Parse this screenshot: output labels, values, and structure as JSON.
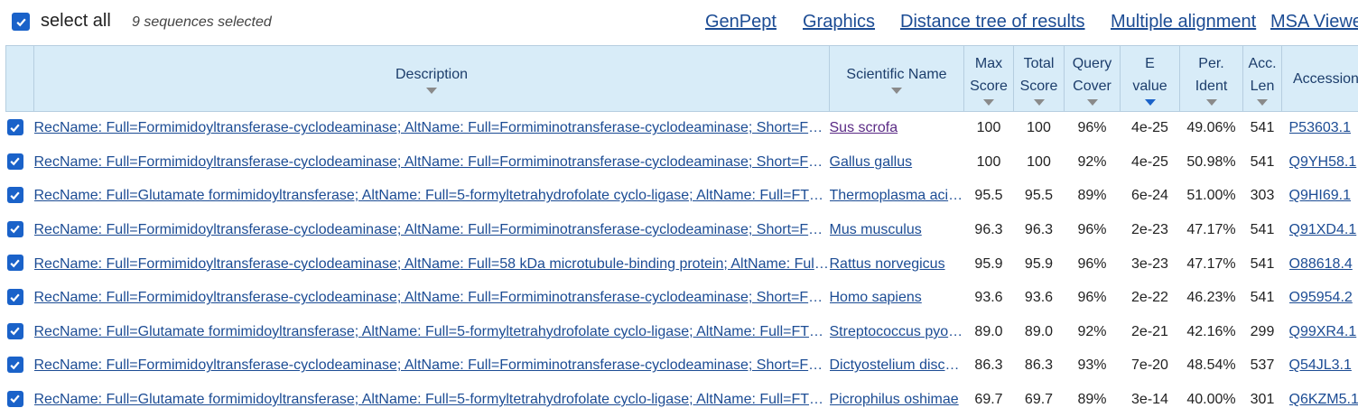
{
  "toolbar": {
    "select_all_label": "select all",
    "selected_count": "9 sequences selected",
    "links": [
      "GenPept",
      "Graphics",
      "Distance tree of results",
      "Multiple alignment",
      "MSA Viewer"
    ]
  },
  "colors": {
    "checkbox": "#1a62c9",
    "header_bg": "#d8ecf8",
    "link": "#1c4c94",
    "visited_link": "#5a2a85"
  },
  "table": {
    "headers": {
      "description": "Description",
      "scientific_name": "Scientific Name",
      "max_score_1": "Max",
      "max_score_2": "Score",
      "total_score_1": "Total",
      "total_score_2": "Score",
      "query_cover_1": "Query",
      "query_cover_2": "Cover",
      "evalue_1": "E",
      "evalue_2": "value",
      "per_ident_1": "Per.",
      "per_ident_2": "Ident",
      "acc_len_1": "Acc.",
      "acc_len_2": "Len",
      "accession": "Accession"
    },
    "rows": [
      {
        "description": "RecName: Full=Formimidoyltransferase-cyclodeaminase; AltName: Full=Formiminotransferase-cyclodeaminase; Short=FTCD",
        "scientific_name": "Sus scrofa",
        "max_score": "100",
        "total_score": "100",
        "query_cover": "96%",
        "evalue": "4e-25",
        "per_ident": "49.06%",
        "acc_len": "541",
        "accession": "P53603.1"
      },
      {
        "description": "RecName: Full=Formimidoyltransferase-cyclodeaminase; AltName: Full=Formiminotransferase-cyclodeaminase; Short=FTCD",
        "scientific_name": "Gallus gallus",
        "max_score": "100",
        "total_score": "100",
        "query_cover": "92%",
        "evalue": "4e-25",
        "per_ident": "50.98%",
        "acc_len": "541",
        "accession": "Q9YH58.1"
      },
      {
        "description": "RecName: Full=Glutamate formimidoyltransferase; AltName: Full=5-formyltetrahydrofolate cyclo-ligase; AltName: Full=FTCD",
        "scientific_name": "Thermoplasma acidophilum",
        "max_score": "95.5",
        "total_score": "95.5",
        "query_cover": "89%",
        "evalue": "6e-24",
        "per_ident": "51.00%",
        "acc_len": "303",
        "accession": "Q9HI69.1"
      },
      {
        "description": "RecName: Full=Formimidoyltransferase-cyclodeaminase; AltName: Full=Formiminotransferase-cyclodeaminase; Short=FTCD",
        "scientific_name": "Mus musculus",
        "max_score": "96.3",
        "total_score": "96.3",
        "query_cover": "96%",
        "evalue": "2e-23",
        "per_ident": "47.17%",
        "acc_len": "541",
        "accession": "Q91XD4.1"
      },
      {
        "description": "RecName: Full=Formimidoyltransferase-cyclodeaminase; AltName: Full=58 kDa microtubule-binding protein; AltName: Full=FTCD",
        "scientific_name": "Rattus norvegicus",
        "max_score": "95.9",
        "total_score": "95.9",
        "query_cover": "96%",
        "evalue": "3e-23",
        "per_ident": "47.17%",
        "acc_len": "541",
        "accession": "O88618.4"
      },
      {
        "description": "RecName: Full=Formimidoyltransferase-cyclodeaminase; AltName: Full=Formiminotransferase-cyclodeaminase; Short=FTCD",
        "scientific_name": "Homo sapiens",
        "max_score": "93.6",
        "total_score": "93.6",
        "query_cover": "96%",
        "evalue": "2e-22",
        "per_ident": "46.23%",
        "acc_len": "541",
        "accession": "O95954.2"
      },
      {
        "description": "RecName: Full=Glutamate formimidoyltransferase; AltName: Full=5-formyltetrahydrofolate cyclo-ligase; AltName: Full=FTCD",
        "scientific_name": "Streptococcus pyogenes",
        "max_score": "89.0",
        "total_score": "89.0",
        "query_cover": "92%",
        "evalue": "2e-21",
        "per_ident": "42.16%",
        "acc_len": "299",
        "accession": "Q99XR4.1"
      },
      {
        "description": "RecName: Full=Formimidoyltransferase-cyclodeaminase; AltName: Full=Formiminotransferase-cyclodeaminase; Short=FTCD",
        "scientific_name": "Dictyostelium discoideum",
        "max_score": "86.3",
        "total_score": "86.3",
        "query_cover": "93%",
        "evalue": "7e-20",
        "per_ident": "48.54%",
        "acc_len": "537",
        "accession": "Q54JL3.1"
      },
      {
        "description": "RecName: Full=Glutamate formimidoyltransferase; AltName: Full=5-formyltetrahydrofolate cyclo-ligase; AltName: Full=FTCD",
        "scientific_name": "Picrophilus oshimae",
        "max_score": "69.7",
        "total_score": "69.7",
        "query_cover": "89%",
        "evalue": "3e-14",
        "per_ident": "40.00%",
        "acc_len": "301",
        "accession": "Q6KZM5.1"
      }
    ]
  }
}
